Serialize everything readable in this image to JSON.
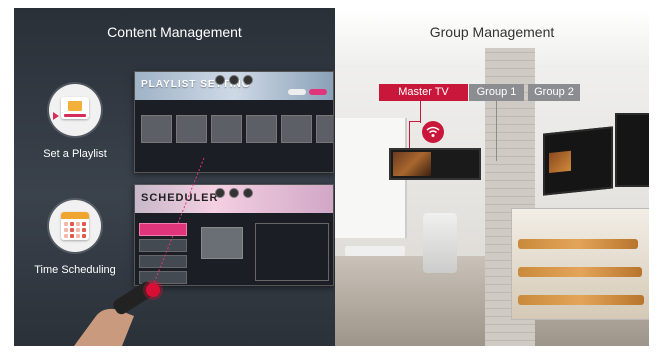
{
  "left_panel": {
    "title": "Content Management",
    "features": [
      {
        "label": "Set a Playlist",
        "icon": "playlist-icon"
      },
      {
        "label": "Time Scheduling",
        "icon": "calendar-icon"
      }
    ],
    "playlist_screen": {
      "title": "PLAYLIST SETTING"
    },
    "scheduler_screen": {
      "title": "SCHEDULER"
    }
  },
  "right_panel": {
    "title": "Group Management",
    "tags": {
      "master": "Master TV",
      "group1": "Group 1",
      "group2": "Group 2"
    },
    "wifi_icon": "wifi-icon"
  },
  "colors": {
    "accent": "#c8173a",
    "pink": "#e0357a",
    "panel_dark": "#2f353e",
    "tag_grey": "#8b8d90"
  }
}
